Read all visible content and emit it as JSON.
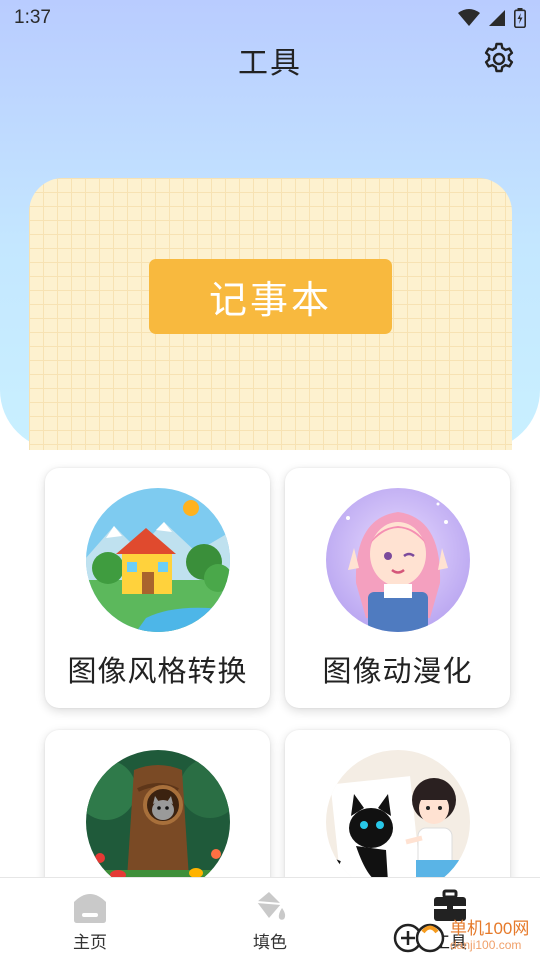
{
  "status_bar": {
    "time": "1:37"
  },
  "header": {
    "title": "工具"
  },
  "notebook": {
    "label": "记事本"
  },
  "tools": [
    {
      "label": "图像风格转换",
      "image": "cottage-landscape-illustration"
    },
    {
      "label": "图像动漫化",
      "image": "anime-girl-illustration"
    },
    {
      "label": "",
      "image": "tree-hollow-cat-illustration"
    },
    {
      "label": "",
      "image": "black-cat-and-girl-drawing"
    }
  ],
  "bottom_nav": [
    {
      "label": "主页",
      "icon": "home-icon"
    },
    {
      "label": "填色",
      "icon": "paint-bucket-icon"
    },
    {
      "label": "工具",
      "icon": "toolbox-icon"
    }
  ],
  "watermark": {
    "text": "单机100网",
    "url": "danji100.com"
  },
  "colors": {
    "header_gradient_top": "#b9ccff",
    "header_gradient_bottom": "#c9f0ff",
    "notebook_bg": "#fdf1cf",
    "notebook_button": "#f8b93e"
  }
}
